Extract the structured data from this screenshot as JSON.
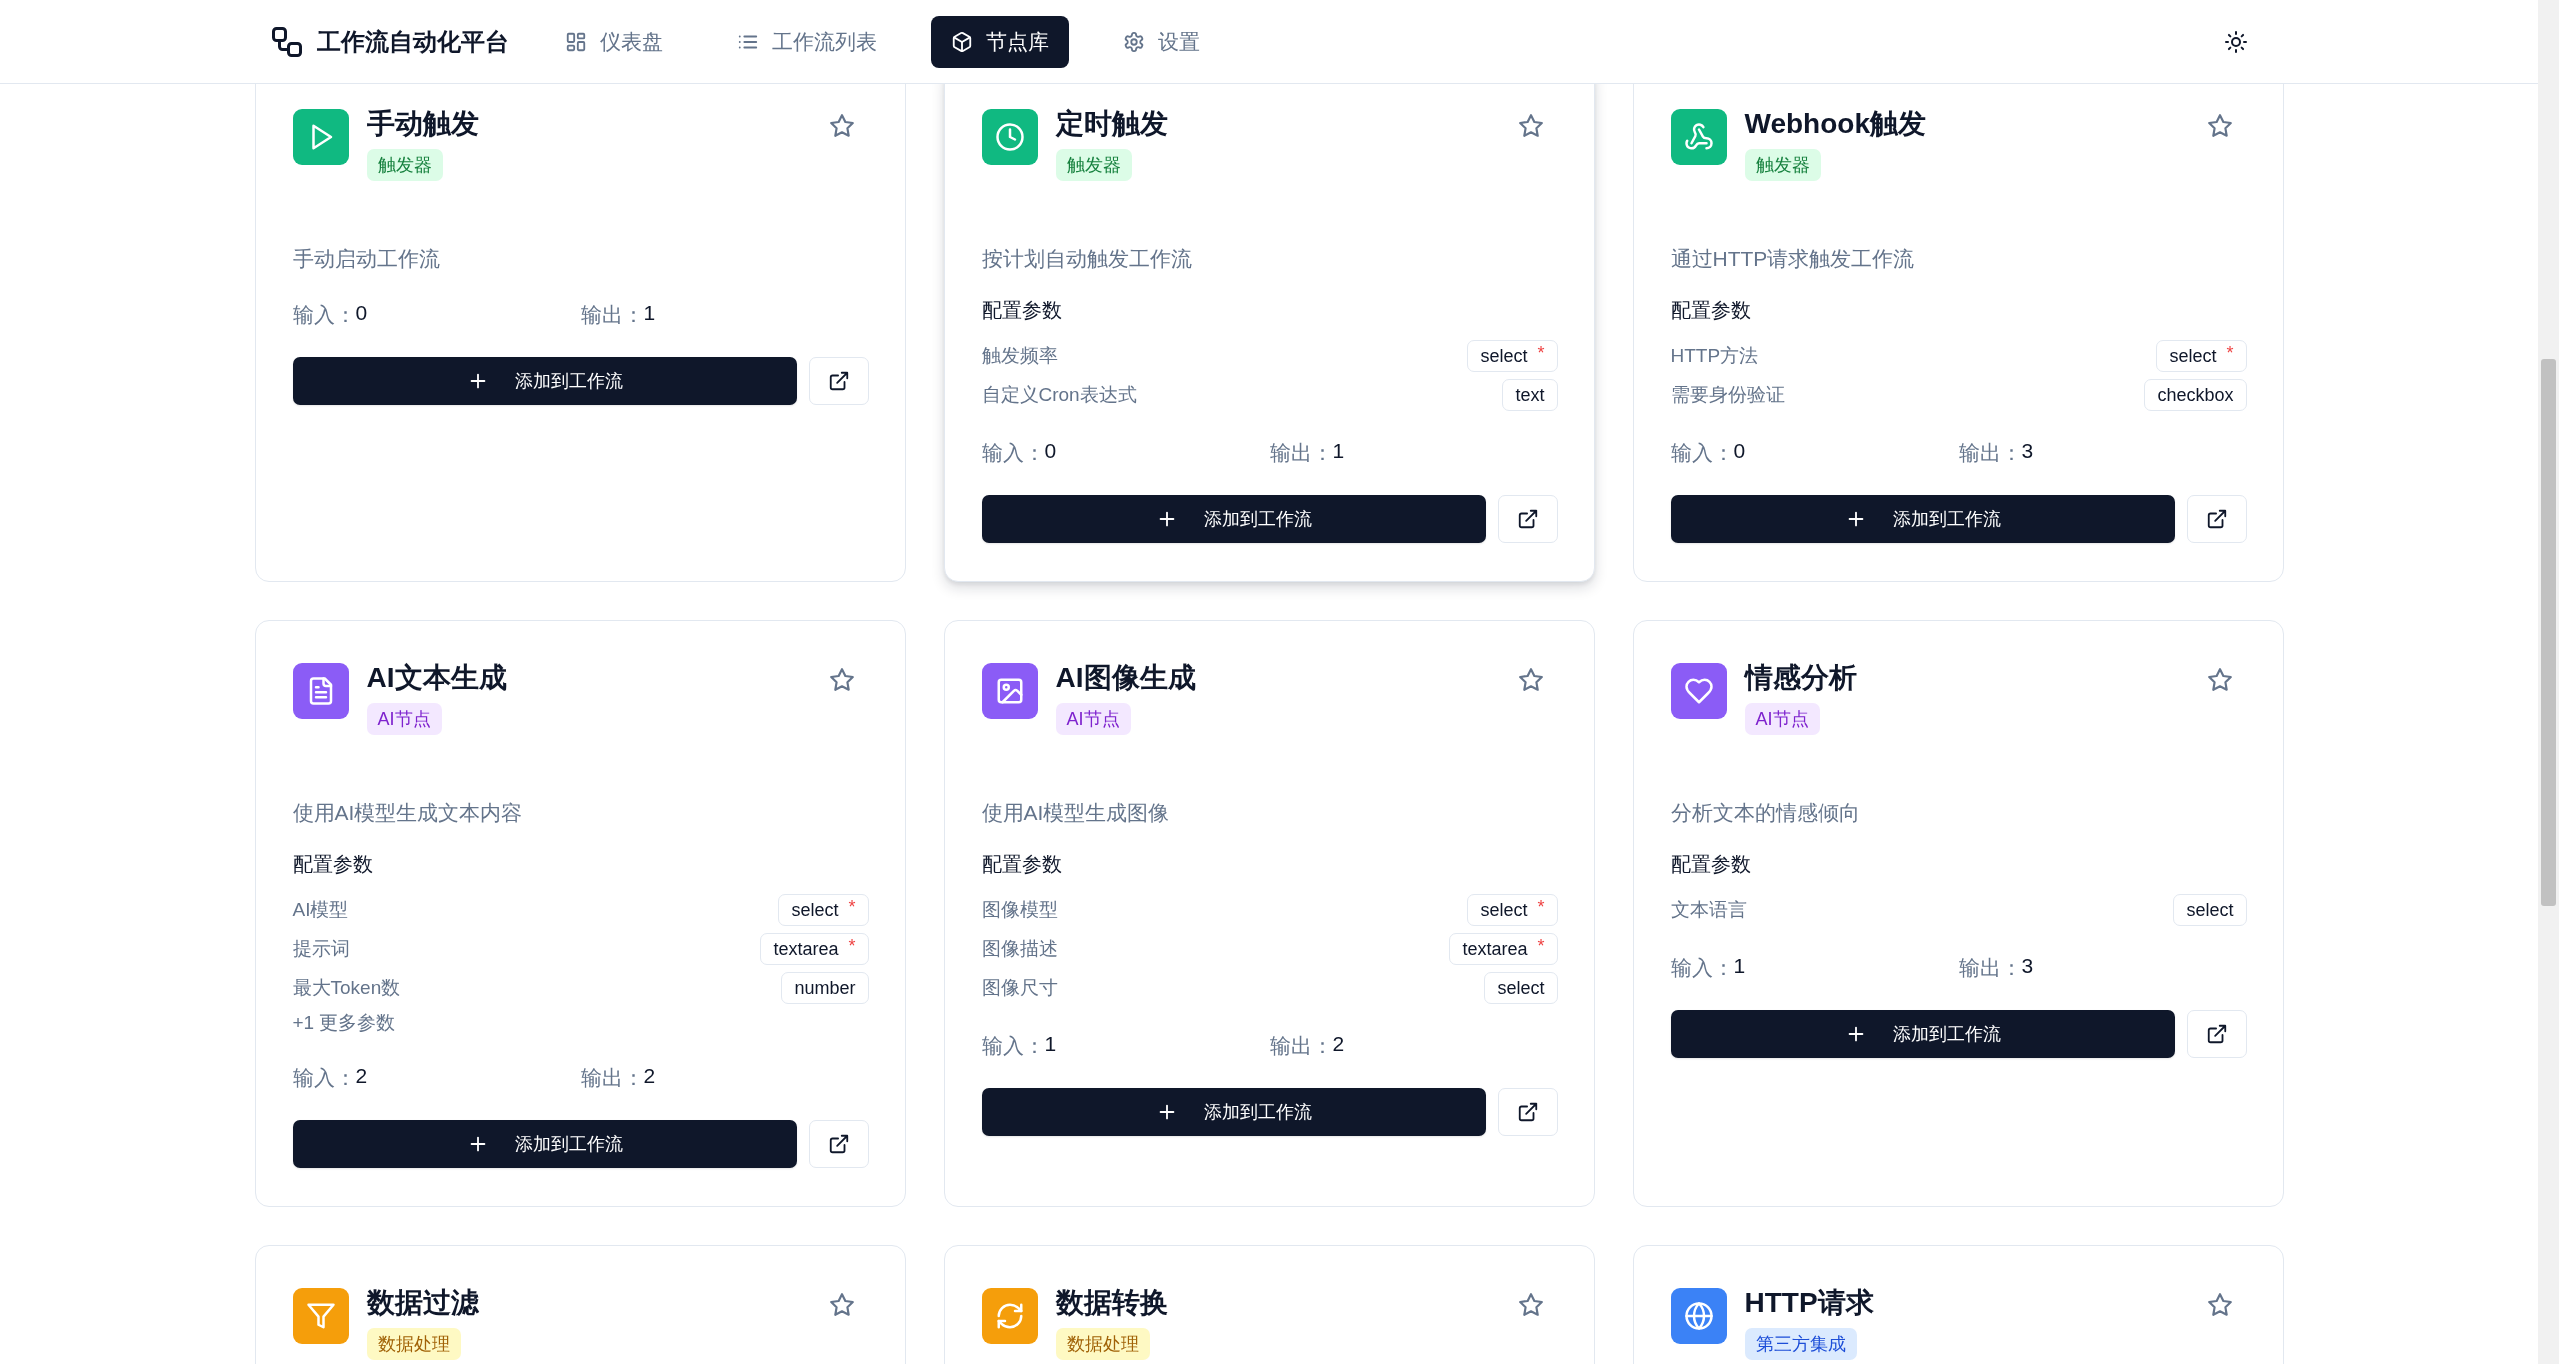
{
  "header": {
    "app_title": "工作流自动化平台",
    "nav": [
      {
        "label": "仪表盘",
        "kind": "dashboard",
        "selected": false
      },
      {
        "label": "工作流列表",
        "kind": "list",
        "selected": false
      },
      {
        "label": "节点库",
        "kind": "nodes",
        "selected": true
      },
      {
        "label": "设置",
        "kind": "settings",
        "selected": false
      }
    ]
  },
  "nodes": [
    {
      "title": "手动触发",
      "kind": "play",
      "color": "#10b981",
      "category": {
        "label": "触发器",
        "kind": "trigger"
      },
      "favorited": false,
      "hovered": false,
      "description": "手动启动工作流",
      "inputs_label": "输入：",
      "inputs": "0",
      "outputs_label": "输出：",
      "outputs": "1",
      "add_label": "添加到工作流"
    },
    {
      "title": "定时触发",
      "kind": "clock",
      "color": "#10b981",
      "category": {
        "label": "触发器",
        "kind": "trigger"
      },
      "favorited": false,
      "hovered": true,
      "description": "按计划自动触发工作流",
      "params_heading": "配置参数",
      "params": [
        {
          "label": "触发频率",
          "type": "select",
          "required_mark": "*"
        },
        {
          "label": "自定义Cron表达式",
          "type": "text"
        }
      ],
      "inputs_label": "输入：",
      "inputs": "0",
      "outputs_label": "输出：",
      "outputs": "1",
      "add_label": "添加到工作流"
    },
    {
      "title": "Webhook触发",
      "kind": "webhook",
      "color": "#10b981",
      "category": {
        "label": "触发器",
        "kind": "trigger"
      },
      "favorited": false,
      "hovered": false,
      "description": "通过HTTP请求触发工作流",
      "params_heading": "配置参数",
      "params": [
        {
          "label": "HTTP方法",
          "type": "select",
          "required_mark": "*"
        },
        {
          "label": "需要身份验证",
          "type": "checkbox"
        }
      ],
      "inputs_label": "输入：",
      "inputs": "0",
      "outputs_label": "输出：",
      "outputs": "3",
      "add_label": "添加到工作流"
    },
    {
      "title": "AI文本生成",
      "kind": "file",
      "color": "#8b5cf6",
      "category": {
        "label": "AI节点",
        "kind": "ai"
      },
      "favorited": false,
      "hovered": false,
      "description": "使用AI模型生成文本内容",
      "params_heading": "配置参数",
      "params": [
        {
          "label": "AI模型",
          "type": "select",
          "required_mark": "*"
        },
        {
          "label": "提示词",
          "type": "textarea",
          "required_mark": "*"
        },
        {
          "label": "最大Token数",
          "type": "number"
        }
      ],
      "more_params": "+1 更多参数",
      "inputs_label": "输入：",
      "inputs": "2",
      "outputs_label": "输出：",
      "outputs": "2",
      "add_label": "添加到工作流"
    },
    {
      "title": "AI图像生成",
      "kind": "image",
      "color": "#8b5cf6",
      "category": {
        "label": "AI节点",
        "kind": "ai"
      },
      "favorited": false,
      "hovered": false,
      "description": "使用AI模型生成图像",
      "params_heading": "配置参数",
      "params": [
        {
          "label": "图像模型",
          "type": "select",
          "required_mark": "*"
        },
        {
          "label": "图像描述",
          "type": "textarea",
          "required_mark": "*"
        },
        {
          "label": "图像尺寸",
          "type": "select"
        }
      ],
      "inputs_label": "输入：",
      "inputs": "1",
      "outputs_label": "输出：",
      "outputs": "2",
      "add_label": "添加到工作流"
    },
    {
      "title": "情感分析",
      "kind": "heart",
      "color": "#8b5cf6",
      "category": {
        "label": "AI节点",
        "kind": "ai"
      },
      "favorited": false,
      "hovered": false,
      "description": "分析文本的情感倾向",
      "params_heading": "配置参数",
      "params": [
        {
          "label": "文本语言",
          "type": "select"
        }
      ],
      "inputs_label": "输入：",
      "inputs": "1",
      "outputs_label": "输出：",
      "outputs": "3",
      "add_label": "添加到工作流"
    },
    {
      "title": "数据过滤",
      "kind": "filter",
      "color": "#f59e0b",
      "category": {
        "label": "数据处理",
        "kind": "data"
      },
      "favorited": false,
      "hovered": false
    },
    {
      "title": "数据转换",
      "kind": "refresh",
      "color": "#f59e0b",
      "category": {
        "label": "数据处理",
        "kind": "data"
      },
      "favorited": false,
      "hovered": false
    },
    {
      "title": "HTTP请求",
      "kind": "globe",
      "color": "#3b82f6",
      "category": {
        "label": "第三方集成",
        "kind": "integration"
      },
      "favorited": false,
      "hovered": false
    }
  ]
}
